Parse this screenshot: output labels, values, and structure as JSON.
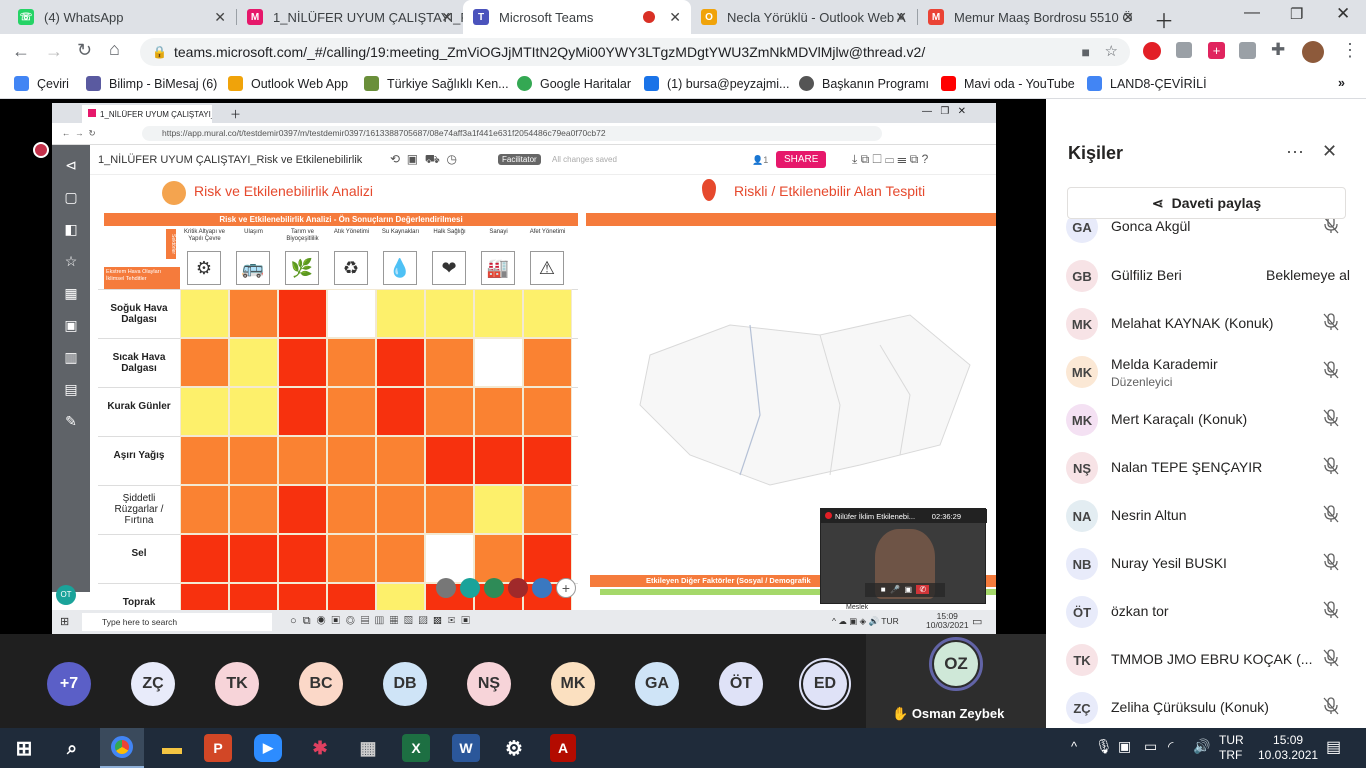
{
  "browser": {
    "tabs": [
      {
        "label": "(4) WhatsApp",
        "fav_color": "#25d366",
        "fav_glyph": "☏"
      },
      {
        "label": "1_NİLÜFER UYUM ÇALIŞTAYI_R",
        "fav_color": "#e6186b",
        "fav_glyph": "M"
      },
      {
        "label": "Microsoft Teams",
        "fav_color": "#4b53bc",
        "fav_glyph": "T"
      },
      {
        "label": "Necla Yörüklü - Outlook Web A",
        "fav_color": "#f0a30a",
        "fav_glyph": "O"
      },
      {
        "label": "Memur Maaş Bordrosu 5510 Ö",
        "fav_color": "#ea4335",
        "fav_glyph": "M"
      }
    ],
    "url": "teams.microsoft.com/_#/calling/19:meeting_ZmViOGJjMTItN2QyMi00YWY3LTgzMDgtYWU3ZmNkMDVlMjlw@thread.v2/",
    "bookmarks": [
      {
        "label": "Çeviri",
        "color": "#4285f4"
      },
      {
        "label": "Bilimp - BiMesaj (6)",
        "color": "#5a5aa0"
      },
      {
        "label": "Outlook Web App",
        "color": "#f0a30a"
      },
      {
        "label": "Türkiye Sağlıklı Ken...",
        "color": "#6a8f3a"
      },
      {
        "label": "Google Haritalar",
        "color": "#34a853"
      },
      {
        "label": "(1) bursa@peyzajmi...",
        "color": "#1a73e8"
      },
      {
        "label": "Başkanın Programı",
        "color": "#555555"
      },
      {
        "label": "Mavi oda - YouTube",
        "color": "#ff0000"
      },
      {
        "label": "LAND8-ÇEVİRİLİ",
        "color": "#4285f4"
      }
    ]
  },
  "share": {
    "inner_tab": "1_NİLÜFER UYUM ÇALIŞTAYI_Ri",
    "inner_url": "https://app.mural.co/t/testdemir0397/m/testdemir0397/1613388705687/08e74aff3a1f441e631f2054486c79ea0f70cb72",
    "mural_title": "1_NİLÜFER UYUM ÇALIŞTAYI_Risk ve Etkilenebilirlik",
    "facilitator": "Facilitator",
    "saved": "All changes saved",
    "share_btn": "SHARE",
    "user_count": "1",
    "left_heading": "Risk ve Etkilenebilirlik Analizi",
    "right_heading": "Riskli / Etkilenebilir Alan Tespiti",
    "banner": "Risk ve Etkilenebilirlik Analizi - Ön Sonuçların Değerlendirilmesi",
    "sectors_label": "Sektörler",
    "hazards_label": "Ekstrem Hava Olayları İklimsel Tehditler",
    "columns": [
      "Kritik Altyapı ve Yapılı Çevre",
      "Ulaşım",
      "Tarım ve Biyoçeşitlilik",
      "Atık Yönetimi",
      "Su Kaynakları",
      "Halk Sağlığı",
      "Sanayi",
      "Afet Yönetimi"
    ],
    "column_icons": [
      "⚙",
      "🚌",
      "🌿",
      "♻",
      "💧",
      "❤",
      "🏭",
      "⚠"
    ],
    "rows": [
      {
        "label": "Soğuk Hava Dalgası",
        "colors": [
          "#fdf06b",
          "#fa8232",
          "#f7310e",
          "#ffffff",
          "#fdf06b",
          "#fdf06b",
          "#fdf06b",
          "#fdf06b"
        ]
      },
      {
        "label": "Sıcak Hava Dalgası",
        "colors": [
          "#fa8232",
          "#fdf06b",
          "#f7310e",
          "#fa8232",
          "#f7310e",
          "#fa8232",
          "#ffffff",
          "#fa8232"
        ]
      },
      {
        "label": "Kurak Günler",
        "colors": [
          "#fdf06b",
          "#fdf06b",
          "#f7310e",
          "#fa8232",
          "#f7310e",
          "#fa8232",
          "#fa8232",
          "#fa8232"
        ]
      },
      {
        "label": "Aşırı Yağış",
        "colors": [
          "#fa8232",
          "#fa8232",
          "#fa8232",
          "#fa8232",
          "#fa8232",
          "#f7310e",
          "#f7310e",
          "#f7310e"
        ]
      },
      {
        "label": "Şiddetli Rüzgarlar / Fırtına",
        "colors": [
          "#fa8232",
          "#fa8232",
          "#f7310e",
          "#fa8232",
          "#fa8232",
          "#fa8232",
          "#fdf06b",
          "#fa8232"
        ]
      },
      {
        "label": "Sel",
        "colors": [
          "#f7310e",
          "#f7310e",
          "#f7310e",
          "#fa8232",
          "#fa8232",
          "#ffffff",
          "#fa8232",
          "#f7310e"
        ]
      },
      {
        "label": "Toprak",
        "colors": [
          "#f7310e",
          "#f7310e",
          "#f7310e",
          "#f7310e",
          "#fdf06b",
          "#f7310e",
          "#f7310e",
          "#f7310e"
        ]
      }
    ],
    "bottom_bar": "Etkileyen Diğer Faktörler (Sosyal / Demografik",
    "bottom_tag": "Meslek",
    "video_name": "Nilüfer İklim Etkilenebi...",
    "video_time": "02:36:29",
    "in_search": "Type here to search",
    "in_lang": "TUR",
    "in_time": "15:09",
    "in_date": "10/03/2021",
    "left_avatar": "OT"
  },
  "people_panel": {
    "title": "Kişiler",
    "share_invite": "Daveti paylaş",
    "people": [
      {
        "initials": "GA",
        "name": "Gonca Akgül",
        "sub": "",
        "status": "",
        "bg": "#e8ebfa"
      },
      {
        "initials": "GB",
        "name": "Gülfiliz Beri",
        "sub": "",
        "status": "Beklemeye al",
        "bg": "#f7e3e6"
      },
      {
        "initials": "MK",
        "name": "Melahat KAYNAK (Konuk)",
        "sub": "",
        "status": "",
        "bg": "#f7e3e6"
      },
      {
        "initials": "MK",
        "name": "Melda Karademir",
        "sub": "Düzenleyici",
        "status": "",
        "bg": "#fbe8d5"
      },
      {
        "initials": "MK",
        "name": "Mert Karaçalı (Konuk)",
        "sub": "",
        "status": "",
        "bg": "#f4e1f3"
      },
      {
        "initials": "NŞ",
        "name": "Nalan TEPE ŞENÇAYIR",
        "sub": "",
        "status": "",
        "bg": "#f7e3e6"
      },
      {
        "initials": "NA",
        "name": "Nesrin Altun",
        "sub": "",
        "status": "",
        "bg": "#e3edf2"
      },
      {
        "initials": "NB",
        "name": "Nuray Yesil BUSKI",
        "sub": "",
        "status": "",
        "bg": "#e8ebfa"
      },
      {
        "initials": "ÖT",
        "name": "özkan tor",
        "sub": "",
        "status": "",
        "bg": "#e8ebfa"
      },
      {
        "initials": "TK",
        "name": "TMMOB JMO EBRU KOÇAK (...",
        "sub": "",
        "status": "",
        "bg": "#f7e3e6"
      },
      {
        "initials": "ZÇ",
        "name": "Zeliha Çürüksulu (Konuk)",
        "sub": "",
        "status": "",
        "bg": "#e8ebfa"
      }
    ]
  },
  "gallery": {
    "participants": [
      {
        "initials": "+7",
        "bg": "#5b5fc7",
        "fg": "#ffffff"
      },
      {
        "initials": "ZÇ",
        "bg": "#e8ebfa",
        "fg": "#333333"
      },
      {
        "initials": "TK",
        "bg": "#f7d4d9",
        "fg": "#333333"
      },
      {
        "initials": "BC",
        "bg": "#fbd8c8",
        "fg": "#333333"
      },
      {
        "initials": "DB",
        "bg": "#cfe4f7",
        "fg": "#333333"
      },
      {
        "initials": "NŞ",
        "bg": "#f7d4d9",
        "fg": "#333333"
      },
      {
        "initials": "MK",
        "bg": "#fbe0c0",
        "fg": "#333333"
      },
      {
        "initials": "GA",
        "bg": "#cfe4f7",
        "fg": "#333333"
      },
      {
        "initials": "ÖT",
        "bg": "#dfe2f7",
        "fg": "#333333"
      },
      {
        "initials": "ED",
        "bg": "#dfe2f7",
        "fg": "#333333"
      }
    ],
    "speaker_initials": "OZ",
    "speaker_name": "Osman Zeybek",
    "accent": "#5b5fc7"
  },
  "taskbar": {
    "lang1": "TUR",
    "lang2": "TRF",
    "time": "15:09",
    "date": "10.03.2021"
  }
}
